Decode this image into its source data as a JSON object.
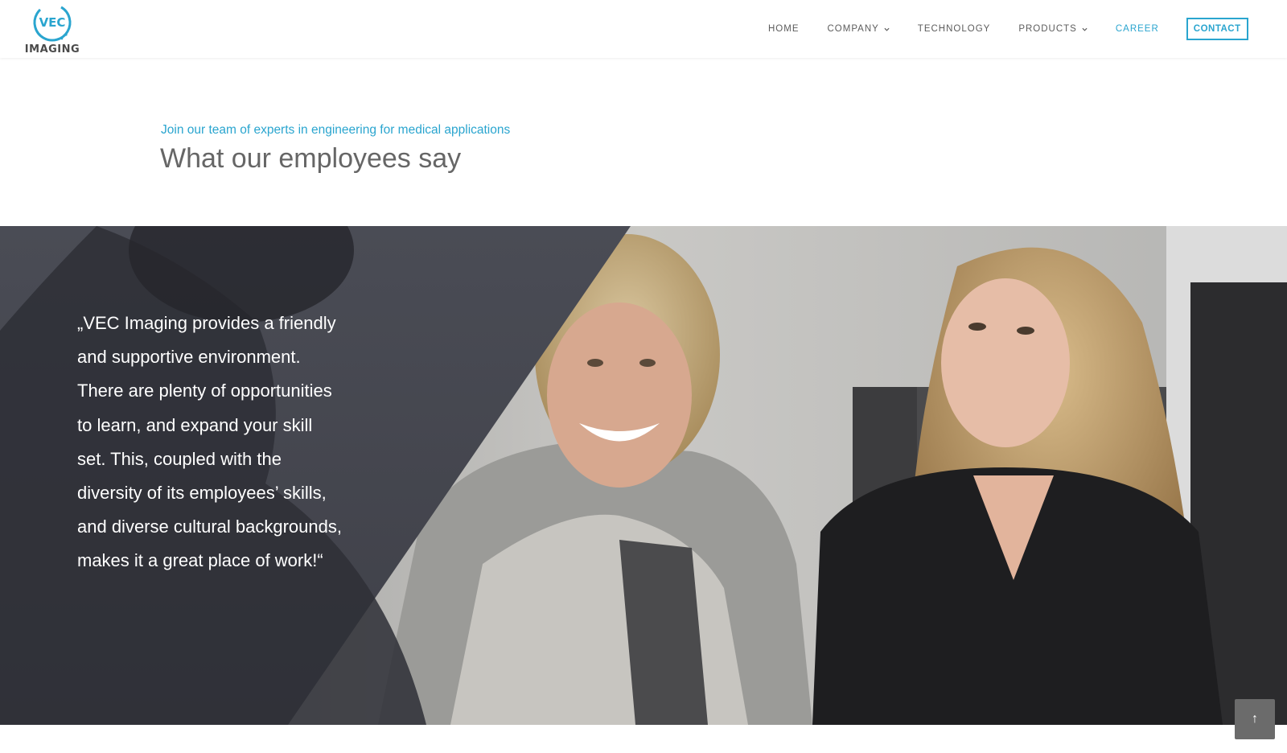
{
  "brand": {
    "logo_letters": "VEC",
    "logo_sub": "IMAGING",
    "accent_color": "#2aa5cf"
  },
  "nav": {
    "items": [
      {
        "label": "HOME",
        "has_dropdown": false,
        "active": false
      },
      {
        "label": "COMPANY",
        "has_dropdown": true,
        "active": false
      },
      {
        "label": "TECHNOLOGY",
        "has_dropdown": false,
        "active": false
      },
      {
        "label": "PRODUCTS",
        "has_dropdown": true,
        "active": false
      },
      {
        "label": "CAREER",
        "has_dropdown": false,
        "active": true
      }
    ],
    "contact_label": "CONTACT"
  },
  "intro": {
    "subtitle": "Join our team of experts in engineering for medical applications",
    "title": "What our employees say"
  },
  "testimonial": {
    "quote": "„VEC Imaging provides a friendly and supportive environment. There are plenty of opportunities to learn, and expand your skill set. This, coupled with the diversity of its employees’ skills, and diverse cultural backgrounds, makes it a great place of work!“"
  },
  "scroll_top": {
    "icon": "arrow-up-icon",
    "glyph": "↑"
  }
}
